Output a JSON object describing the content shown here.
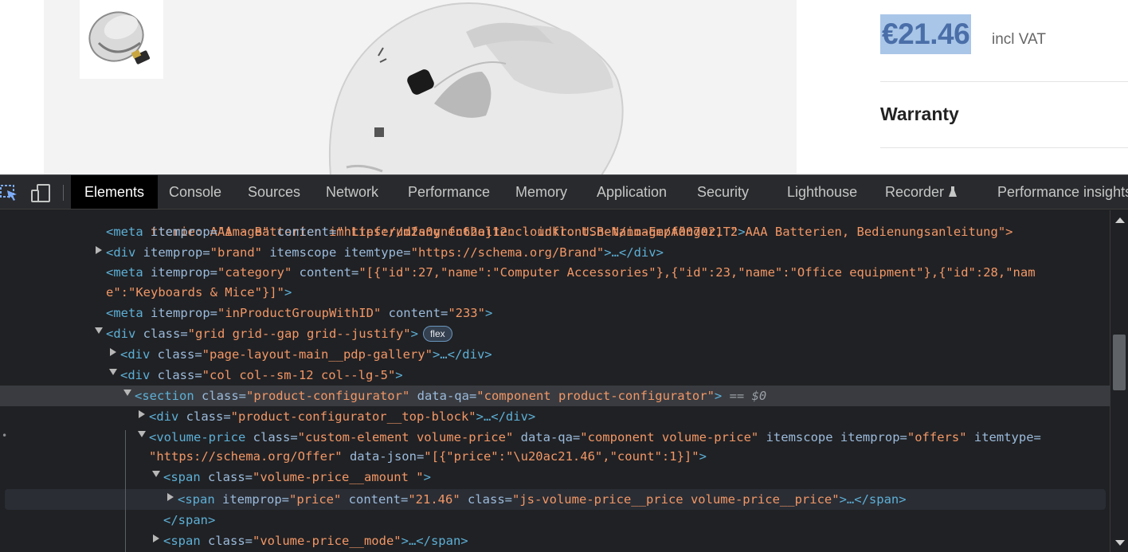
{
  "product": {
    "price": "€21.46",
    "vat_label": "incl VAT",
    "warranty_label": "Warranty"
  },
  "devtools": {
    "tabs": [
      {
        "label": "Elements"
      },
      {
        "label": "Console"
      },
      {
        "label": "Sources"
      },
      {
        "label": "Network"
      },
      {
        "label": "Performance"
      },
      {
        "label": "Memory"
      },
      {
        "label": "Application"
      },
      {
        "label": "Security"
      },
      {
        "label": "Lighthouse"
      },
      {
        "label": "Recorder"
      },
      {
        "label": "Performance insights"
      }
    ],
    "active_tab": "Elements",
    "tree": {
      "l0": "tterie: AAA · Batterien im Lieferumfang enthalten · inkl. USB-Nano-Empfänger, 2 AAA Batterien, Bedienungsanleitung\">",
      "l1": {
        "tag": "<meta",
        "attr1": " itemprop=",
        "val1": "\"image\"",
        "attr2": " content=",
        "val2": "\"https://d2s0ynfc62ej12.cloudfront.net/image/A007021T\"",
        "close": ">"
      },
      "l2": {
        "tag": "<div",
        "attr1": " itemprop=",
        "val1": "\"brand\"",
        "attr2": " itemscope itemtype=",
        "val2": "\"https://schema.org/Brand\"",
        "close": ">…</div>"
      },
      "l3": {
        "tag": "<meta",
        "attr1": " itemprop=",
        "val1": "\"category\"",
        "attr2": " content=",
        "val2": "\"[{\"id\":27,\"name\":\"Computer Accessories\"},{\"id\":23,\"name\":\"Office equipment\"},{\"id\":28,\"nam"
      },
      "l4": {
        "val": "e\":\"Keyboards & Mice\"}]\"",
        "close": ">"
      },
      "l5": {
        "tag": "<meta",
        "attr1": " itemprop=",
        "val1": "\"inProductGroupWithID\"",
        "attr2": " content=",
        "val2": "\"233\"",
        "close": ">"
      },
      "l6": {
        "tag": "<div",
        "attr1": " class=",
        "val1": "\"grid grid--gap grid--justify\"",
        "close": ">",
        "badge": "flex"
      },
      "l7": {
        "tag": "<div",
        "attr1": " class=",
        "val1": "\"page-layout-main__pdp-gallery\"",
        "close": ">…</div>"
      },
      "l8": {
        "tag": "<div",
        "attr1": " class=",
        "val1": "\"col col--sm-12 col--lg-5\"",
        "close": ">"
      },
      "l9": {
        "tag": "<section",
        "attr1": " class=",
        "val1": "\"product-configurator\"",
        "attr2": " data-qa=",
        "val2": "\"component product-configurator\"",
        "close": ">",
        "eq": " == $0"
      },
      "l10": {
        "tag": "<div",
        "attr1": " class=",
        "val1": "\"product-configurator__top-block\"",
        "close": ">…</div>"
      },
      "l11": {
        "tag": "<volume-price",
        "attr1": " class=",
        "val1": "\"custom-element volume-price\"",
        "attr2": " data-qa=",
        "val2": "\"component volume-price\"",
        "attr3": " itemscope itemprop=",
        "val3": "\"offers\"",
        "attr4": " itemtype="
      },
      "l12": {
        "val1": "\"https://schema.org/Offer\"",
        "attr1": " data-json=",
        "val2": "\"[{\"price\":\"\\u20ac21.46\",\"count\":1}]\"",
        "close": ">"
      },
      "l13": {
        "tag": "<span",
        "attr1": " class=",
        "val1": "\"volume-price__amount \"",
        "close": ">"
      },
      "l14": {
        "tag": "<span",
        "attr1": " itemprop=",
        "val1": "\"price\"",
        "attr2": " content=",
        "val2": "\"21.46\"",
        "attr3": " class=",
        "val3": "\"js-volume-price__price volume-price__price\"",
        "close": ">…</span>"
      },
      "l15": {
        "tag": "</span>"
      },
      "l16": {
        "tag": "<span",
        "attr1": " class=",
        "val1": "\"volume-price__mode\"",
        "close": ">…</span>"
      }
    }
  }
}
